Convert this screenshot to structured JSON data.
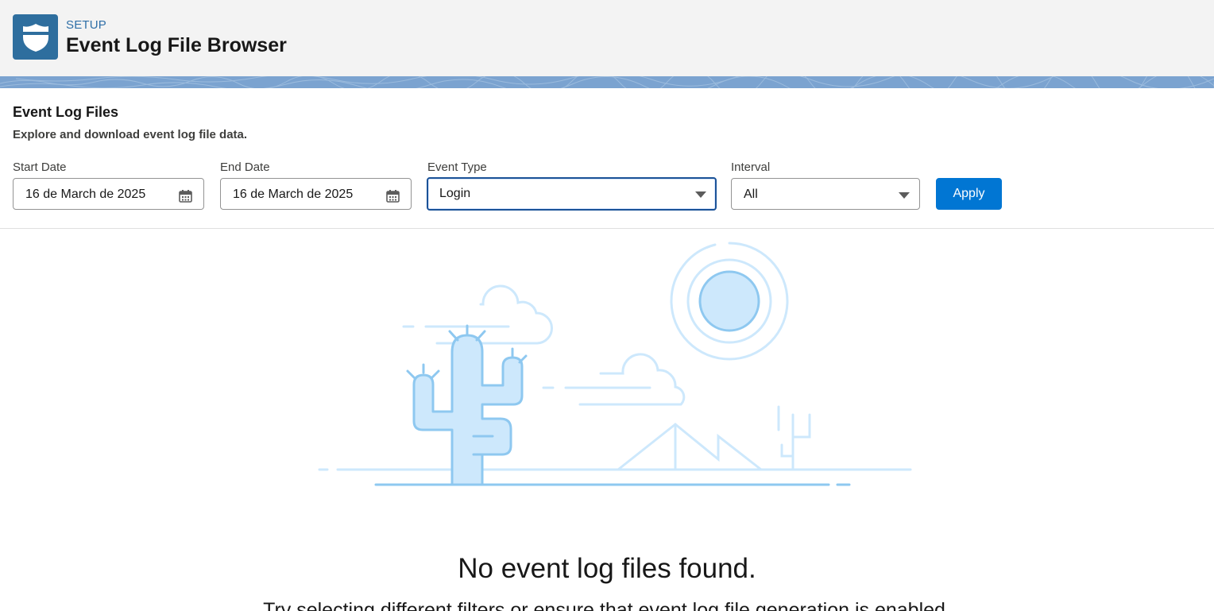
{
  "header": {
    "kicker": "SETUP",
    "title": "Event Log File Browser",
    "icon": "shield-icon",
    "icon_bg": "#2e6e9e"
  },
  "section": {
    "title": "Event Log Files",
    "subtitle": "Explore and download event log file data."
  },
  "filters": {
    "start_date": {
      "label": "Start Date",
      "value": "16 de March de 2025",
      "icon": "calendar-icon"
    },
    "end_date": {
      "label": "End Date",
      "value": "16 de March de 2025",
      "icon": "calendar-icon"
    },
    "event_type": {
      "label": "Event Type",
      "value": "Login",
      "icon": "chevron-down-icon"
    },
    "interval": {
      "label": "Interval",
      "value": "All",
      "icon": "chevron-down-icon"
    },
    "apply_label": "Apply"
  },
  "empty_state": {
    "illustration": "desert-illustration",
    "title": "No event log files found.",
    "message": "Try selecting different filters or ensure that event log file generation is enabled."
  },
  "colors": {
    "brand": "#0176d3",
    "focus_border": "#1b5297",
    "illustration_stroke": "#8ec8f0",
    "illustration_fill": "#cde8fc"
  }
}
